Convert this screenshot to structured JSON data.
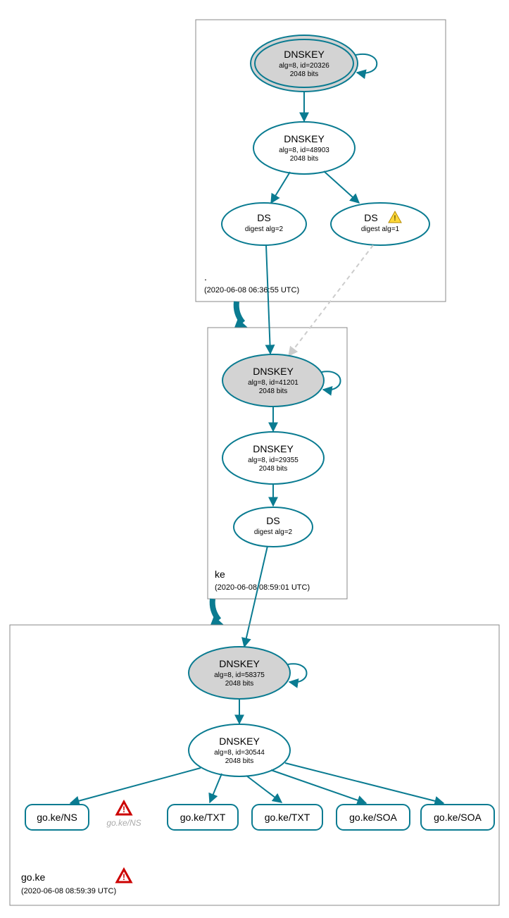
{
  "zones": {
    "root": {
      "name": ".",
      "timestamp": "(2020-06-08 06:36:55 UTC)"
    },
    "ke": {
      "name": "ke",
      "timestamp": "(2020-06-08 08:59:01 UTC)"
    },
    "goke": {
      "name": "go.ke",
      "timestamp": "(2020-06-08 08:59:39 UTC)"
    }
  },
  "nodes": {
    "root_ksk": {
      "title": "DNSKEY",
      "sub1": "alg=8, id=20326",
      "sub2": "2048 bits"
    },
    "root_zsk": {
      "title": "DNSKEY",
      "sub1": "alg=8, id=48903",
      "sub2": "2048 bits"
    },
    "root_ds2": {
      "title": "DS",
      "sub1": "digest alg=2"
    },
    "root_ds1": {
      "title": "DS",
      "sub1": "digest alg=1",
      "warn": true
    },
    "ke_ksk": {
      "title": "DNSKEY",
      "sub1": "alg=8, id=41201",
      "sub2": "2048 bits"
    },
    "ke_zsk": {
      "title": "DNSKEY",
      "sub1": "alg=8, id=29355",
      "sub2": "2048 bits"
    },
    "ke_ds": {
      "title": "DS",
      "sub1": "digest alg=2"
    },
    "goke_ksk": {
      "title": "DNSKEY",
      "sub1": "alg=8, id=58375",
      "sub2": "2048 bits"
    },
    "goke_zsk": {
      "title": "DNSKEY",
      "sub1": "alg=8, id=30544",
      "sub2": "2048 bits"
    },
    "rr_ns": {
      "label": "go.ke/NS"
    },
    "rr_ns_gray": {
      "label": "go.ke/NS"
    },
    "rr_txt1": {
      "label": "go.ke/TXT"
    },
    "rr_txt2": {
      "label": "go.ke/TXT"
    },
    "rr_soa1": {
      "label": "go.ke/SOA"
    },
    "rr_soa2": {
      "label": "go.ke/SOA"
    }
  }
}
